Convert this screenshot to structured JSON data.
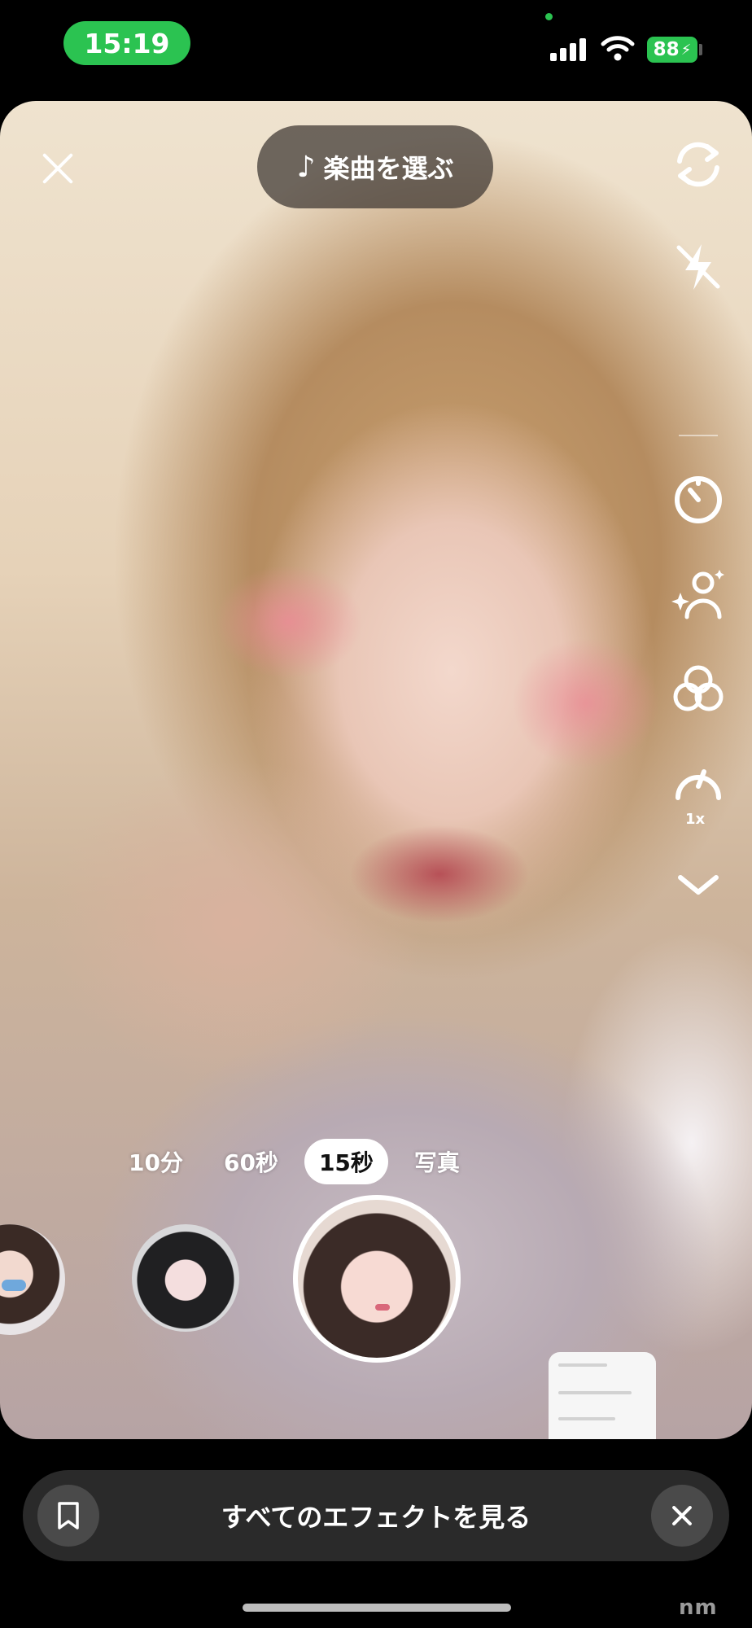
{
  "status": {
    "time": "15:19",
    "battery": "88"
  },
  "camera": {
    "music_label": "楽曲を選ぶ",
    "modes": [
      {
        "label": "10分",
        "active": false
      },
      {
        "label": "60秒",
        "active": false
      },
      {
        "label": "15秒",
        "active": true
      },
      {
        "label": "写真",
        "active": false
      }
    ],
    "speed_label": "1x",
    "tools": [
      "flip-camera-icon",
      "flash-off-icon",
      "timer-icon",
      "beauty-icon",
      "filters-icon",
      "speed-icon",
      "chevron-down-icon"
    ]
  },
  "bottom_bar": {
    "label": "すべてのエフェクトを見る"
  },
  "watermark": "nm"
}
